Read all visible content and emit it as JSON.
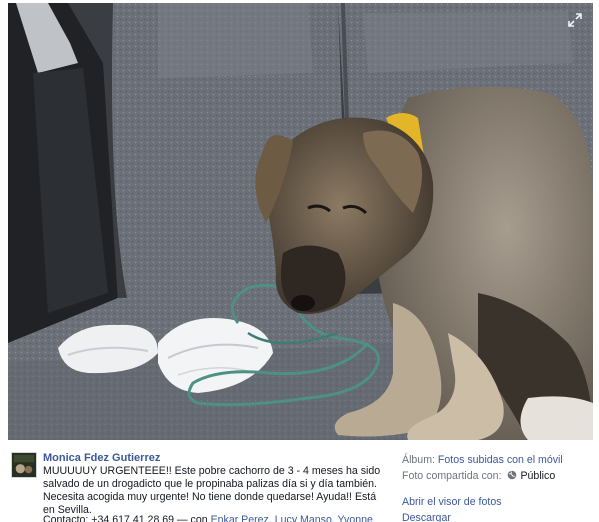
{
  "photo": {
    "description_icon": "photo-of-puppy",
    "expand_icon": "expand-icon"
  },
  "post": {
    "author": "Monica Fdez Gutierrez",
    "caption": "MUUUUUY URGENTEEE!! Este pobre cachorro de 3 - 4 meses ha sido salvado de un drogadicto que le propinaba palizas día si y día también. Necesita acogida muy urgente! No tiene donde quedarse! Ayuda!! Está en Sevilla.",
    "contact_prefix": "Contacto: +34 617 41 28 69 — con ",
    "tagged": "Enkar Perez, Lucy Manso, Yvonne"
  },
  "sidebar": {
    "album_label": "Álbum: ",
    "album_value": "Fotos subidas con el móvil",
    "shared_label": "Foto compartida con: ",
    "shared_value": "Público",
    "open_viewer": "Abrir el visor de fotos",
    "download": "Descargar"
  },
  "colors": {
    "link": "#3b5998",
    "text": "#141823",
    "muted": "#6d7480"
  }
}
